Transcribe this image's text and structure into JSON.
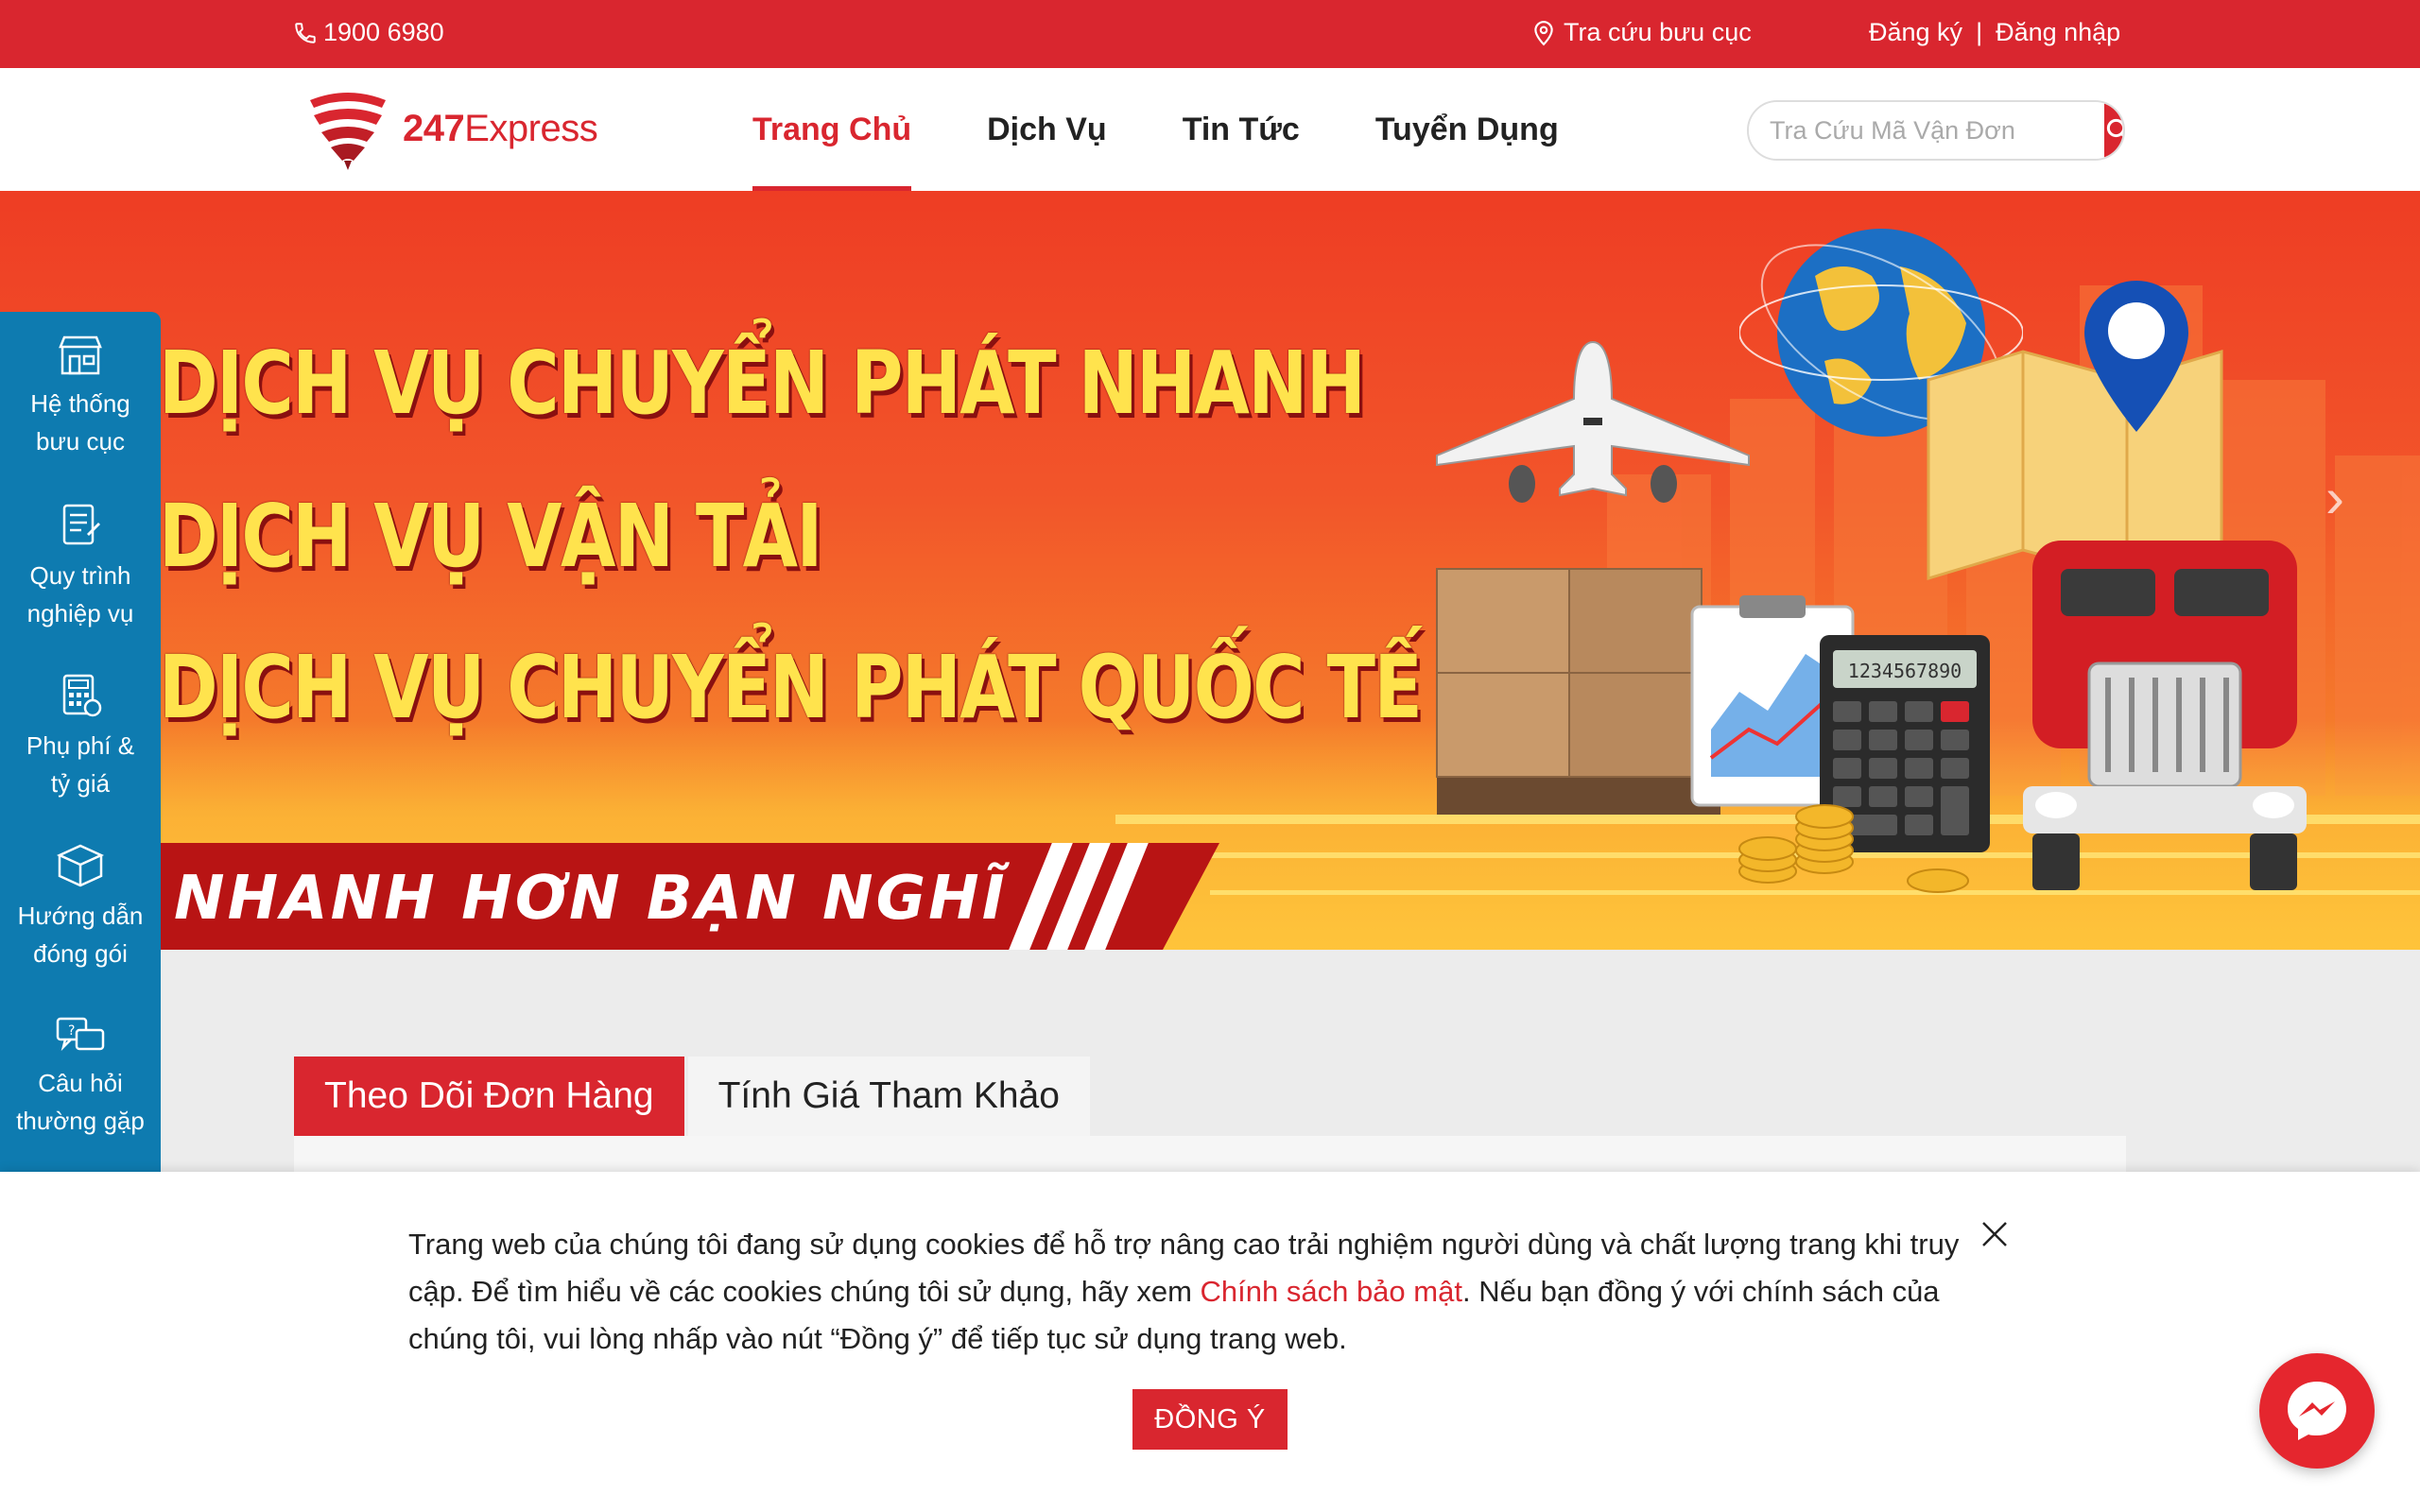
{
  "topbar": {
    "phone": "1900 6980",
    "lookup_label": "Tra cứu bưu cục",
    "register": "Đăng ký",
    "separator": "|",
    "login": "Đăng nhập"
  },
  "logo": {
    "brand_bold": "247",
    "brand_rest": "Express"
  },
  "nav": {
    "items": [
      {
        "label": "Trang Chủ",
        "active": true
      },
      {
        "label": "Dịch Vụ"
      },
      {
        "label": "Tin Tức"
      },
      {
        "label": "Tuyển Dụng"
      }
    ]
  },
  "search": {
    "placeholder": "Tra Cứu Mã Vận Đơn",
    "value": ""
  },
  "banner": {
    "lines": [
      "DỊCH VỤ CHUYỂN PHÁT NHANH",
      "DỊCH VỤ VẬN TẢI",
      "DỊCH VỤ CHUYỂN PHÁT QUỐC TẾ"
    ],
    "slogan": "NHANH HƠN BẠN NGHĨ",
    "calculator_display": "1234567890"
  },
  "sidebar": {
    "items": [
      {
        "line1": "Hệ thống",
        "line2": "bưu cục",
        "icon": "store-icon"
      },
      {
        "line1": "Quy trình",
        "line2": "nghiệp vụ",
        "icon": "document-icon"
      },
      {
        "line1": "Phụ phí &",
        "line2": "tỷ giá",
        "icon": "calculator-icon"
      },
      {
        "line1": "Hướng dẫn",
        "line2": "đóng gói",
        "icon": "package-icon"
      },
      {
        "line1": "Câu hỏi",
        "line2": "thường gặp",
        "icon": "faq-icon"
      }
    ]
  },
  "tabs": {
    "track": "Theo Dõi Đơn Hàng",
    "estimate": "Tính Giá Tham Khảo"
  },
  "cookie": {
    "text_before": "Trang web của chúng tôi đang sử dụng cookies để hỗ trợ nâng cao trải nghiệm người dùng và chất lượng trang khi truy cập. Để tìm hiểu về các cookies chúng tôi sử dụng, hãy xem ",
    "link": "Chính sách bảo mật",
    "text_after": ". Nếu bạn đồng ý với chính sách của chúng tôi, vui lòng nhấp vào nút “Đồng ý” để tiếp tục sử dụng trang web.",
    "accept": "ĐỒNG Ý"
  },
  "colors": {
    "brand_red": "#d9262f",
    "sidebar_blue": "#0e7bb0",
    "headline_yellow": "#ffe34d"
  }
}
